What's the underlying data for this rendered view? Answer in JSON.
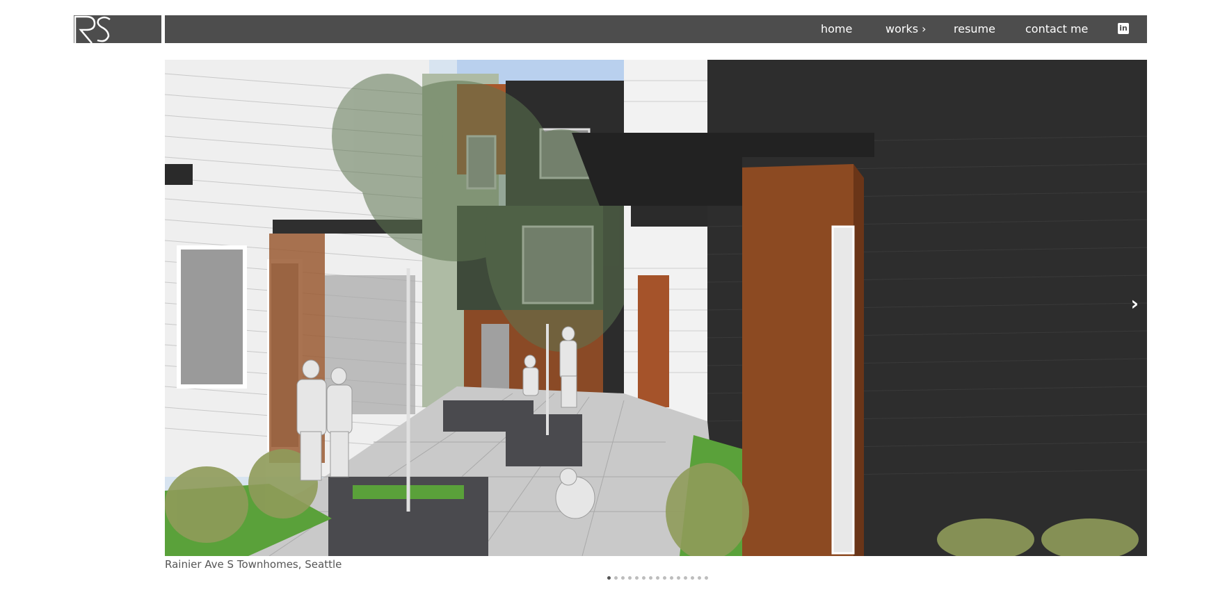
{
  "header": {
    "logo_text": "RS",
    "nav": [
      {
        "label": "home"
      },
      {
        "label": "works ›"
      },
      {
        "label": "resume"
      },
      {
        "label": "contact me"
      }
    ],
    "linkedin_icon": "linkedin-icon"
  },
  "slideshow": {
    "caption": "Rainier Ave S Townhomes, Seattle",
    "next_icon": "›",
    "slide_count": 15,
    "active_index": 0
  },
  "colors": {
    "header_bg": "#4d4d4d",
    "text_light": "#ffffff",
    "caption_text": "#555555"
  }
}
